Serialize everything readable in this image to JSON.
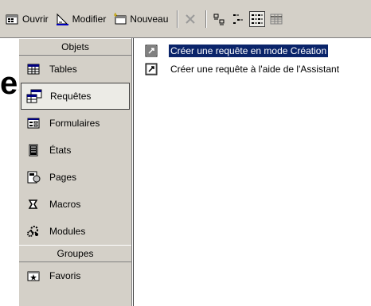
{
  "toolbar": {
    "open_label": "Ouvrir",
    "modify_label": "Modifier",
    "new_label": "Nouveau"
  },
  "background_fragment": "es",
  "sidebar": {
    "objects_header": "Objets",
    "items": [
      {
        "label": "Tables",
        "icon": "table-icon"
      },
      {
        "label": "Requêtes",
        "icon": "query-icon"
      },
      {
        "label": "Formulaires",
        "icon": "form-icon"
      },
      {
        "label": "États",
        "icon": "report-icon"
      },
      {
        "label": "Pages",
        "icon": "page-icon"
      },
      {
        "label": "Macros",
        "icon": "macro-icon"
      },
      {
        "label": "Modules",
        "icon": "module-icon"
      }
    ],
    "groups_header": "Groupes",
    "groups": [
      {
        "label": "Favoris",
        "icon": "favorites-icon"
      }
    ]
  },
  "main": {
    "items": [
      {
        "label": "Créer une requête en mode Création"
      },
      {
        "label": "Créer une requête à l'aide de l'Assistant"
      }
    ]
  },
  "colors": {
    "chrome": "#d4d0c8",
    "selection": "#0a246a"
  }
}
